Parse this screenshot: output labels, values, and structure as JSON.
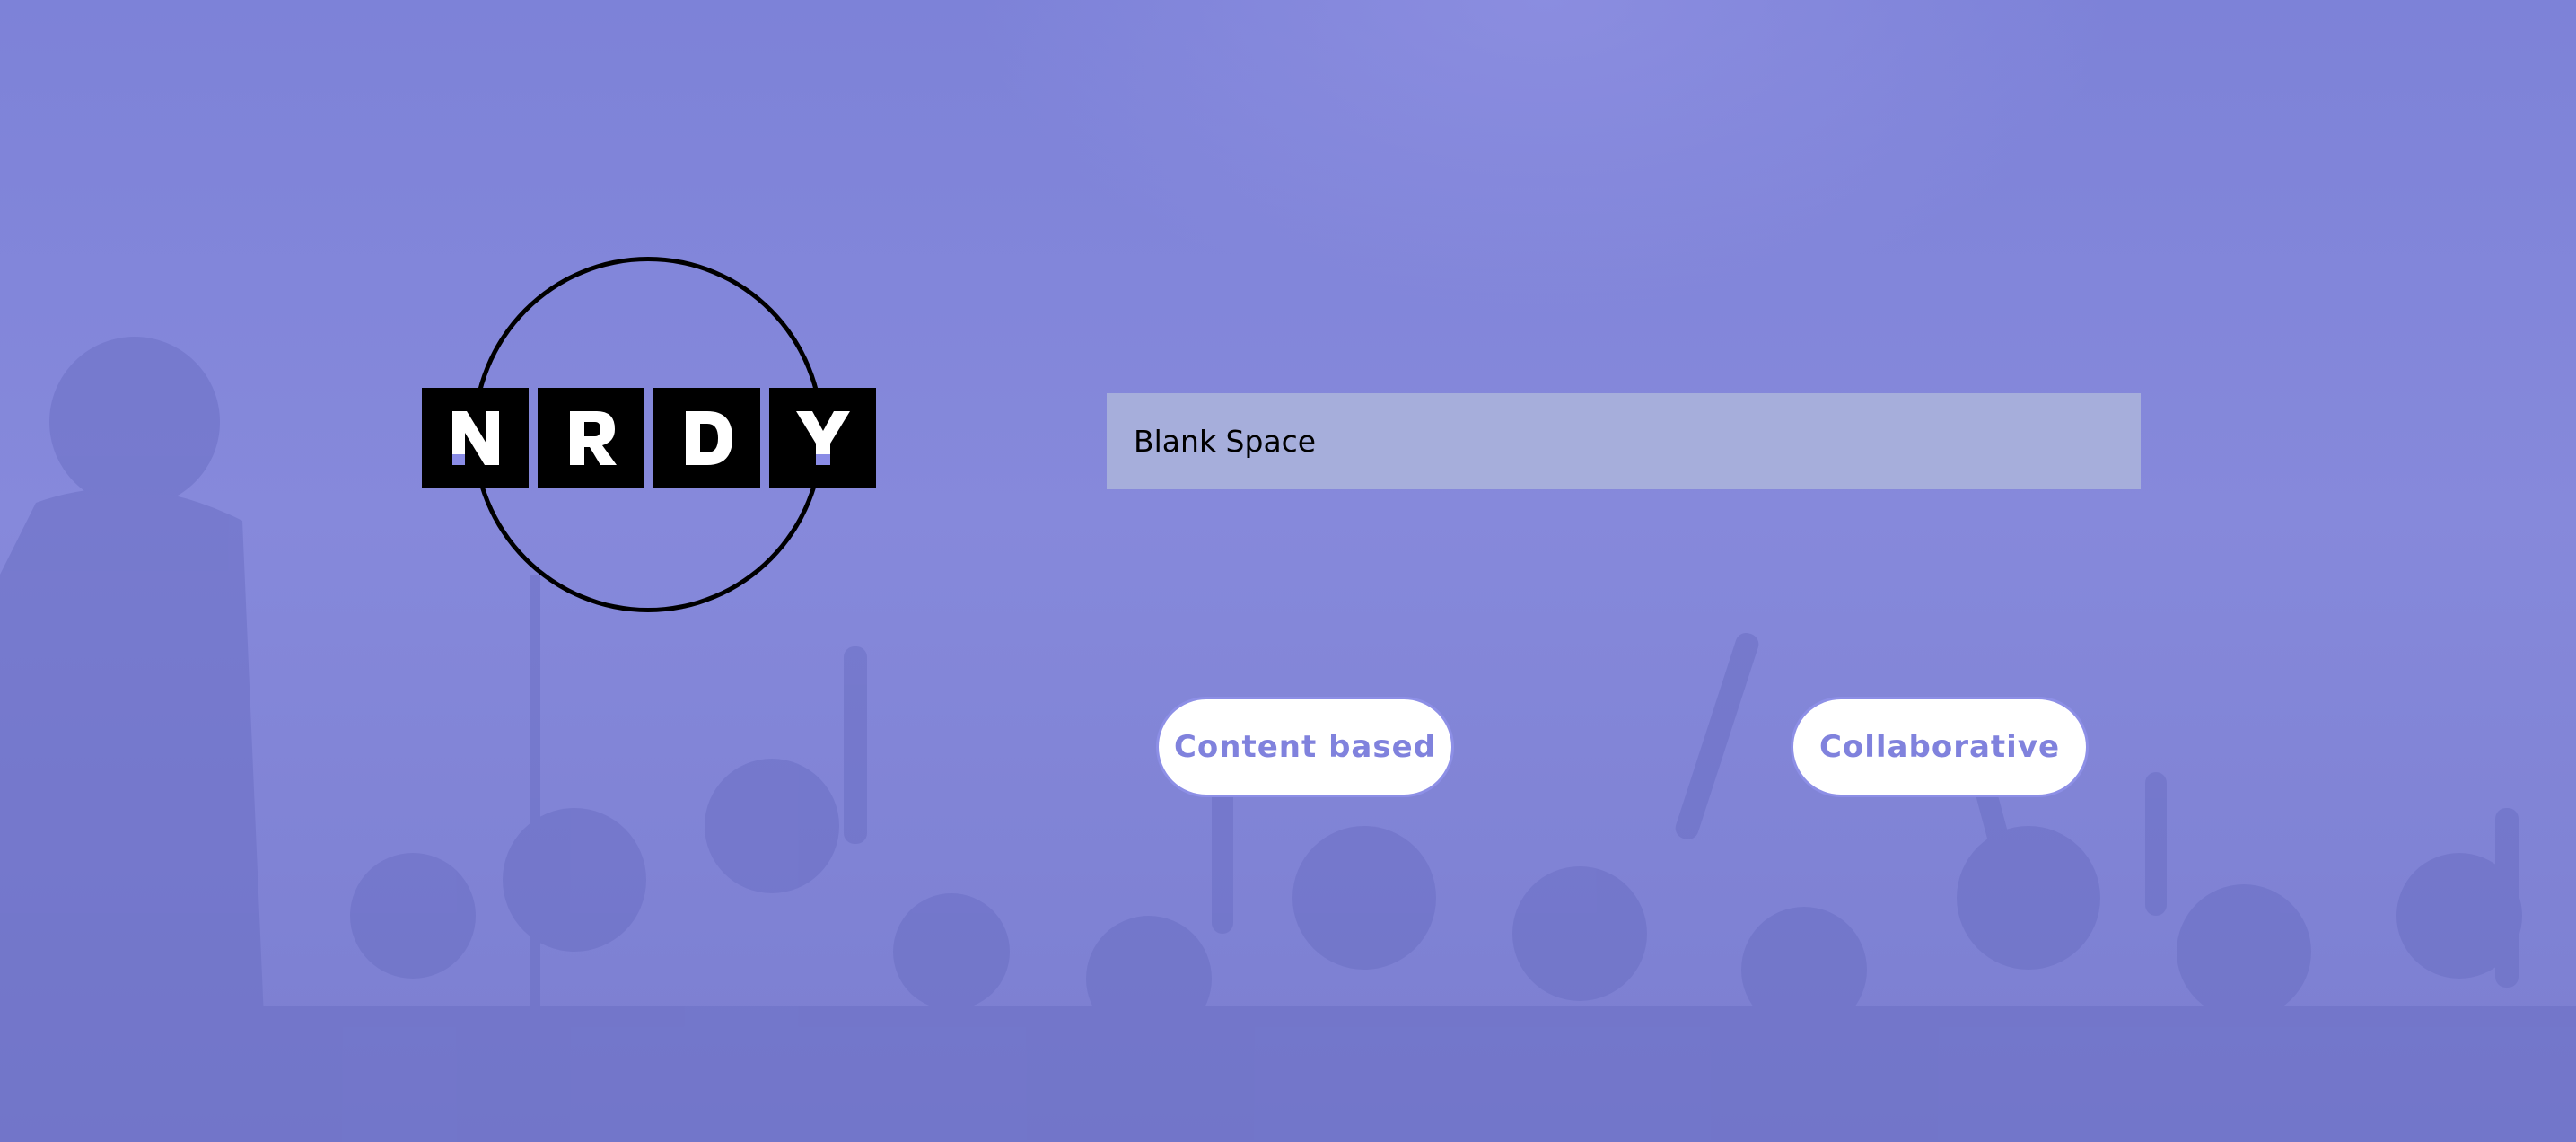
{
  "logo": {
    "letters": [
      "N",
      "R",
      "D",
      "Y"
    ],
    "ring_color": "#000000",
    "tile_color": "#000000",
    "letter_color": "#ffffff",
    "accent_color": "#8a8ce6"
  },
  "search": {
    "value": "Blank Space"
  },
  "buttons": {
    "content_based": "Content based",
    "collaborative": "Collaborative"
  },
  "theme": {
    "overlay": "#7f84d6",
    "field_bg": "#a6aedb",
    "button_text": "#8082dd"
  }
}
